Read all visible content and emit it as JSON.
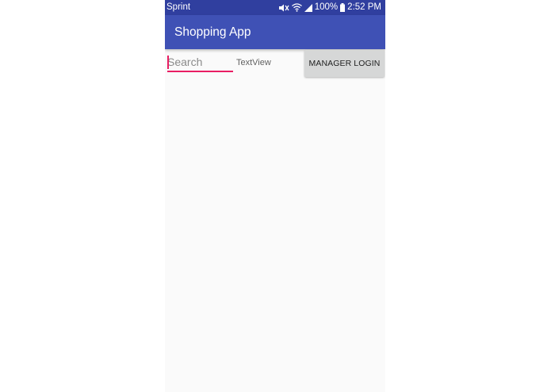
{
  "status_bar": {
    "carrier": "Sprint",
    "battery": "100%",
    "time": "2:52 PM",
    "icons": [
      "mute-icon",
      "wifi-icon",
      "signal-icon",
      "battery-icon"
    ]
  },
  "app_bar": {
    "title": "Shopping App",
    "color": "#3f51b5",
    "status_color": "#303f9f"
  },
  "content": {
    "search": {
      "placeholder": "Search",
      "value": ""
    },
    "textview": "TextView",
    "manager_login_label": "MANAGER LOGIN",
    "accent_color": "#e91e63"
  }
}
